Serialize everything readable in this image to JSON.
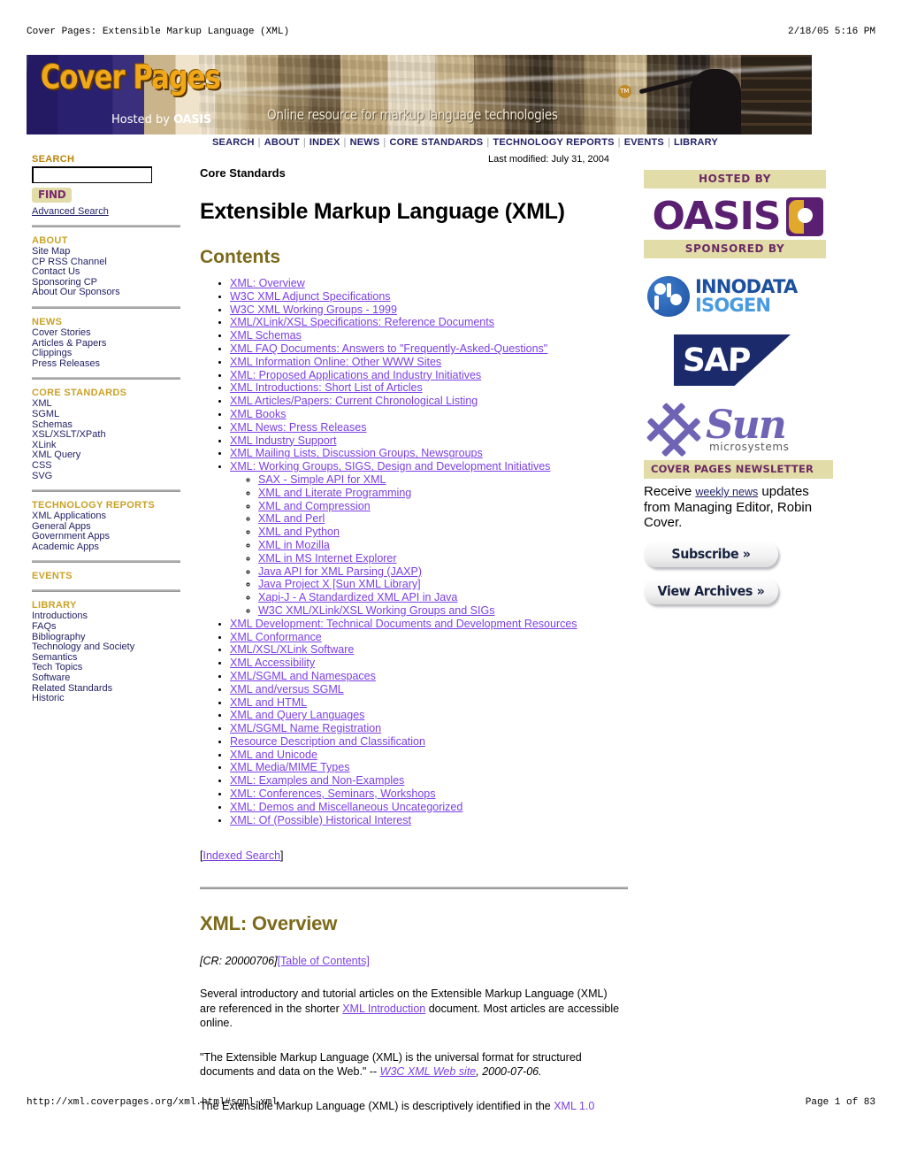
{
  "print": {
    "header_left": "Cover Pages: Extensible Markup Language (XML)",
    "header_right": "2/18/05 5:16 PM",
    "footer_left": "http://xml.coverpages.org/xml.html#sgml-xml",
    "footer_right": "Page 1 of 83"
  },
  "banner": {
    "title": "Cover Pages",
    "hosted_prefix": "Hosted by ",
    "hosted_brand": "OASIS",
    "tagline": "Online resource for markup language technologies",
    "globe_label": "TM"
  },
  "navbar": {
    "items": [
      "SEARCH",
      "ABOUT",
      "INDEX",
      "NEWS",
      "CORE STANDARDS",
      "TECHNOLOGY REPORTS",
      "EVENTS",
      "LIBRARY"
    ],
    "separator": "|"
  },
  "search": {
    "heading": "SEARCH",
    "value": "",
    "placeholder": "",
    "find_label": "FIND",
    "advanced_label": "Advanced Search"
  },
  "sidebar": {
    "sections": [
      {
        "heading": "ABOUT",
        "items": [
          "Site Map",
          "CP RSS Channel",
          "Contact Us",
          "Sponsoring CP",
          "About Our Sponsors"
        ]
      },
      {
        "heading": "NEWS",
        "items": [
          "Cover Stories",
          "Articles & Papers",
          "Clippings",
          "Press Releases"
        ]
      },
      {
        "heading": "CORE STANDARDS",
        "items": [
          "XML",
          "SGML",
          "Schemas",
          "XSL/XSLT/XPath",
          "XLink",
          "XML Query",
          "CSS",
          "SVG"
        ]
      },
      {
        "heading": "TECHNOLOGY REPORTS",
        "items": [
          "XML Applications",
          "General Apps",
          "Government Apps",
          "Academic Apps"
        ]
      },
      {
        "heading": "EVENTS",
        "items": []
      },
      {
        "heading": "LIBRARY",
        "items": [
          "Introductions",
          "FAQs",
          "Bibliography",
          "Technology and Society",
          "Semantics",
          "Tech Topics",
          "Software",
          "Related Standards",
          "Historic"
        ]
      }
    ]
  },
  "main": {
    "last_modified": "Last modified: July 31, 2004",
    "kicker": "Core Standards",
    "title": "Extensible Markup Language (XML)",
    "contents_heading": "Contents",
    "toc": [
      {
        "label": "XML: Overview"
      },
      {
        "label": "W3C XML Adjunct Specifications"
      },
      {
        "label": "W3C XML Working Groups - 1999"
      },
      {
        "label": "XML/XLink/XSL Specifications: Reference Documents"
      },
      {
        "label": "XML Schemas"
      },
      {
        "label": "XML FAQ Documents: Answers to \"Frequently-Asked-Questions\""
      },
      {
        "label": "XML Information Online: Other WWW Sites"
      },
      {
        "label": "XML: Proposed Applications and Industry Initiatives"
      },
      {
        "label": "XML Introductions: Short List of Articles"
      },
      {
        "label": "XML Articles/Papers: Current Chronological Listing"
      },
      {
        "label": "XML Books"
      },
      {
        "label": "XML News: Press Releases"
      },
      {
        "label": "XML Industry Support"
      },
      {
        "label": "XML Mailing Lists, Discussion Groups, Newsgroups"
      },
      {
        "label": "XML: Working Groups, SIGS, Design and Development Initiatives",
        "children": [
          "SAX - Simple API for XML",
          "XML and Literate Programming",
          "XML and Compression",
          "XML and Perl",
          "XML and Python",
          "XML in Mozilla",
          "XML in MS Internet Explorer",
          "Java API for XML Parsing (JAXP)",
          "Java Project X [Sun XML Library]",
          "Xapi-J - A Standardized XML API in Java",
          "W3C XML/XLink/XSL Working Groups and SIGs"
        ]
      },
      {
        "label": "XML Development: Technical Documents and Development Resources"
      },
      {
        "label": "XML Conformance"
      },
      {
        "label": "XML/XSL/XLink Software"
      },
      {
        "label": "XML Accessibility"
      },
      {
        "label": "XML/SGML and Namespaces"
      },
      {
        "label": "XML and/versus SGML"
      },
      {
        "label": "XML and HTML"
      },
      {
        "label": "XML and Query Languages"
      },
      {
        "label": "XML/SGML Name Registration"
      },
      {
        "label": "Resource Description and Classification"
      },
      {
        "label": "XML and Unicode"
      },
      {
        "label": "XML Media/MIME Types"
      },
      {
        "label": "XML: Examples and Non-Examples"
      },
      {
        "label": "XML: Conferences, Seminars, Workshops"
      },
      {
        "label": "XML: Demos and Miscellaneous Uncategorized"
      },
      {
        "label": "XML: Of (Possible) Historical Interest"
      }
    ],
    "indexed_search": {
      "open": "[",
      "label": "Indexed Search",
      "close": "]"
    },
    "overview_heading": "XML: Overview",
    "cr_note": "[CR: 20000706]",
    "toc_link": "[Table of Contents]",
    "para1": {
      "a": "Several introductory and tutorial articles on the Extensible Markup Language (XML) are referenced in the shorter ",
      "link": "XML Introduction",
      "b": " document. Most articles are accessible online."
    },
    "para2": {
      "a": "\"The Extensible Markup Language (XML) is the universal format for structured documents and data on the Web.\" -- ",
      "link": "W3C XML Web site",
      "b": ", 2000-07-06."
    },
    "para3": {
      "a": "The Extensible Markup Language (XML) is descriptively identified in the ",
      "link": "XML 1.0"
    }
  },
  "rail": {
    "hosted_by_label": "HOSTED BY",
    "oasis_word": "OASIS",
    "sponsored_by_label": "SPONSORED BY",
    "innodata_line1": "INNODATA",
    "innodata_line2": "ISOGEN",
    "sap_word": "SAP",
    "sun_word": "Sun",
    "sun_sub": "microsystems",
    "newsletter_label": "COVER PAGES NEWSLETTER",
    "newsletter_text_a": "Receive ",
    "newsletter_link": "weekly news",
    "newsletter_text_b": " updates from Managing Editor, Robin Cover.",
    "subscribe_label": "Subscribe  »",
    "archives_label": "View Archives  »"
  },
  "colors": {
    "link_visited": "#7b3fe4",
    "sidebar_link": "#222266",
    "gold_heading": "#b8860b",
    "olive_heading": "#7c6a1a",
    "oasis_purple": "#5b1f72",
    "band_khaki": "#e2dca8"
  }
}
